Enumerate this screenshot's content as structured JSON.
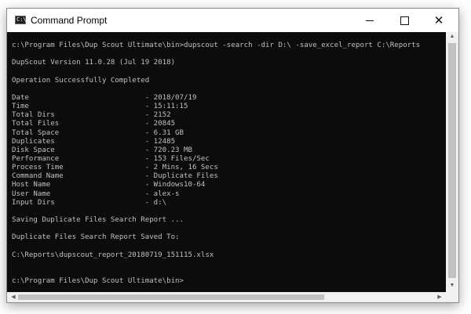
{
  "window": {
    "title": "Command Prompt",
    "icon_label": "C:\\"
  },
  "controls": {
    "minimize": "minimize-icon",
    "maximize": "maximize-icon",
    "close": "close-icon",
    "close_glyph": "✕"
  },
  "console": {
    "lines": [
      "c:\\Program Files\\Dup Scout Ultimate\\bin>dupscout -search -dir D:\\ -save_excel_report C:\\Reports",
      "",
      "DupScout Version 11.0.28 (Jul 19 2018)",
      "",
      "Operation Successfully Completed",
      "",
      "Date                           - 2018/07/19",
      "Time                           - 15:11:15",
      "Total Dirs                     - 2152",
      "Total Files                    - 20845",
      "Total Space                    - 6.31 GB",
      "Duplicates                     - 12485",
      "Disk Space                     - 720.23 MB",
      "Performance                    - 153 Files/Sec",
      "Process Time                   - 2 Mins, 16 Secs",
      "Command Name                   - Duplicate Files",
      "Host Name                      - Windows10-64",
      "User Name                      - alex-s",
      "Input Dirs                     - d:\\",
      "",
      "Saving Duplicate Files Search Report ...",
      "",
      "Duplicate Files Search Report Saved To:",
      "",
      "C:\\Reports\\dupscout_report_20180719_151115.xlsx",
      "",
      "",
      "c:\\Program Files\\Dup Scout Ultimate\\bin>"
    ],
    "text_color": "#c0c0c0",
    "background": "#0c0c0c"
  },
  "scrollbars": {
    "up_arrow": "▲",
    "down_arrow": "▼",
    "left_arrow": "◀",
    "right_arrow": "▶"
  }
}
